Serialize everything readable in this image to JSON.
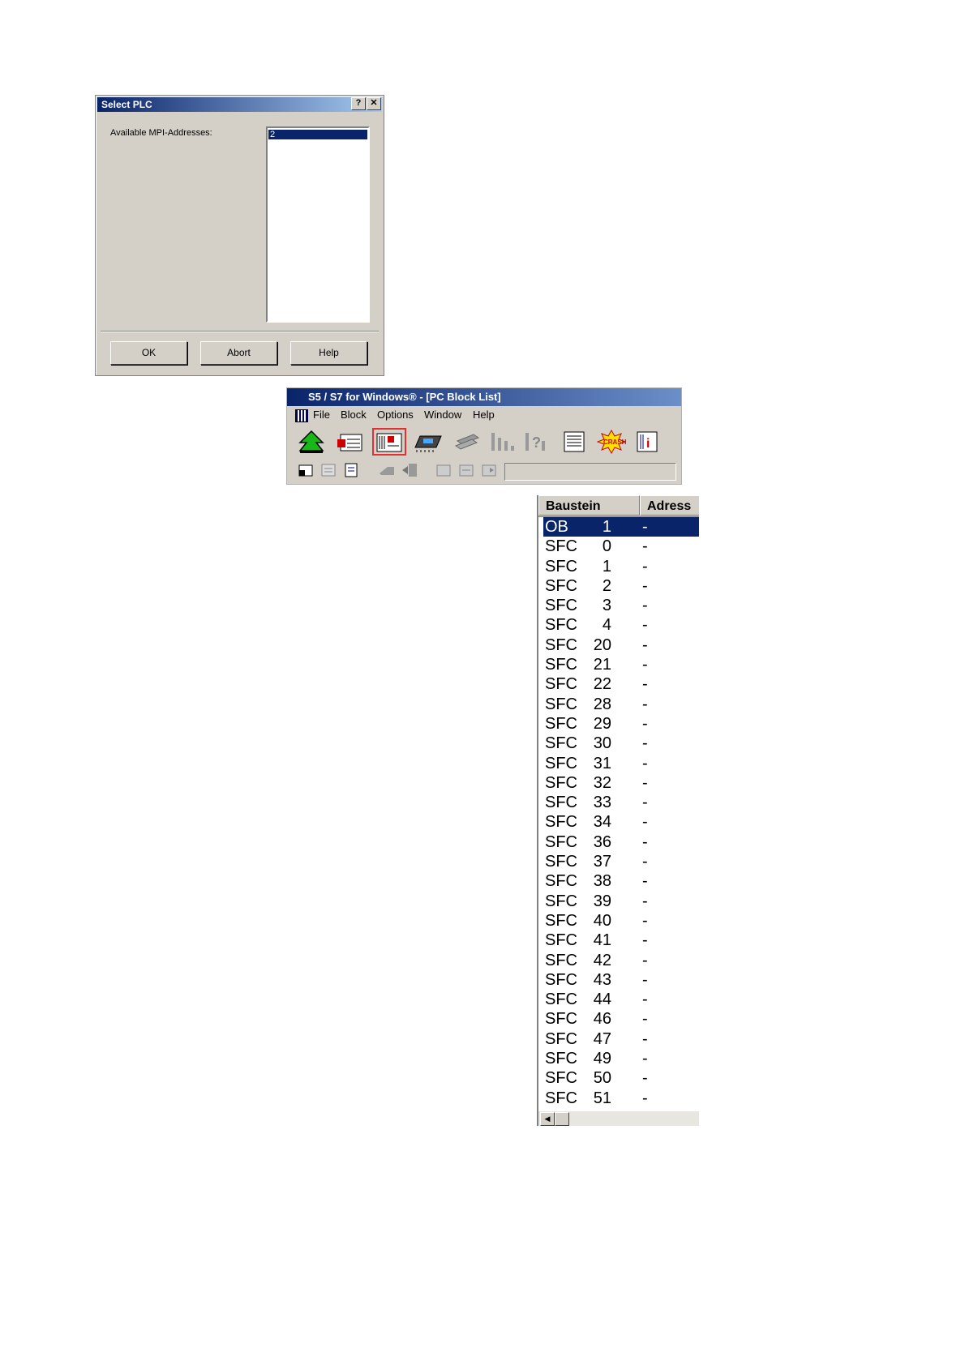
{
  "dialog": {
    "title": "Select PLC",
    "help_glyph": "?",
    "close_glyph": "✕",
    "label": "Available MPI-Addresses:",
    "list_items": [
      "2"
    ],
    "buttons": {
      "ok": "OK",
      "abort": "Abort",
      "help": "Help"
    }
  },
  "main_window": {
    "title": "S5 / S7 for Windows® - [PC Block List]",
    "menu": [
      "File",
      "Block",
      "Options",
      "Window",
      "Help"
    ],
    "toolbar_icons": [
      "upload-arrow-icon",
      "pc-block-list-icon",
      "plc-block-list-icon",
      "memory-card-icon",
      "transfer-icon",
      "bar-chart-icon",
      "unknown-chart-icon",
      "document-icon",
      "crash-icon",
      "plc-info-icon"
    ],
    "toolbar2_icons": [
      "tool-a-icon",
      "tool-b-icon",
      "tool-c-icon",
      "tool-d-icon",
      "tool-e-icon",
      "tool-f-icon",
      "tool-g-icon",
      "tool-h-icon"
    ]
  },
  "block_list": {
    "columns": [
      "Baustein",
      "Adress"
    ],
    "scroll_left_glyph": "◀",
    "rows": [
      {
        "type": "OB",
        "num": "1",
        "addr": "-"
      },
      {
        "type": "SFC",
        "num": "0",
        "addr": "-"
      },
      {
        "type": "SFC",
        "num": "1",
        "addr": "-"
      },
      {
        "type": "SFC",
        "num": "2",
        "addr": "-"
      },
      {
        "type": "SFC",
        "num": "3",
        "addr": "-"
      },
      {
        "type": "SFC",
        "num": "4",
        "addr": "-"
      },
      {
        "type": "SFC",
        "num": "20",
        "addr": "-"
      },
      {
        "type": "SFC",
        "num": "21",
        "addr": "-"
      },
      {
        "type": "SFC",
        "num": "22",
        "addr": "-"
      },
      {
        "type": "SFC",
        "num": "28",
        "addr": "-"
      },
      {
        "type": "SFC",
        "num": "29",
        "addr": "-"
      },
      {
        "type": "SFC",
        "num": "30",
        "addr": "-"
      },
      {
        "type": "SFC",
        "num": "31",
        "addr": "-"
      },
      {
        "type": "SFC",
        "num": "32",
        "addr": "-"
      },
      {
        "type": "SFC",
        "num": "33",
        "addr": "-"
      },
      {
        "type": "SFC",
        "num": "34",
        "addr": "-"
      },
      {
        "type": "SFC",
        "num": "36",
        "addr": "-"
      },
      {
        "type": "SFC",
        "num": "37",
        "addr": "-"
      },
      {
        "type": "SFC",
        "num": "38",
        "addr": "-"
      },
      {
        "type": "SFC",
        "num": "39",
        "addr": "-"
      },
      {
        "type": "SFC",
        "num": "40",
        "addr": "-"
      },
      {
        "type": "SFC",
        "num": "41",
        "addr": "-"
      },
      {
        "type": "SFC",
        "num": "42",
        "addr": "-"
      },
      {
        "type": "SFC",
        "num": "43",
        "addr": "-"
      },
      {
        "type": "SFC",
        "num": "44",
        "addr": "-"
      },
      {
        "type": "SFC",
        "num": "46",
        "addr": "-"
      },
      {
        "type": "SFC",
        "num": "47",
        "addr": "-"
      },
      {
        "type": "SFC",
        "num": "49",
        "addr": "-"
      },
      {
        "type": "SFC",
        "num": "50",
        "addr": "-"
      },
      {
        "type": "SFC",
        "num": "51",
        "addr": "-"
      }
    ]
  },
  "colors": {
    "selection": "#0a246a",
    "face": "#d4d0c8",
    "toolbar_highlight": "#e03030"
  }
}
